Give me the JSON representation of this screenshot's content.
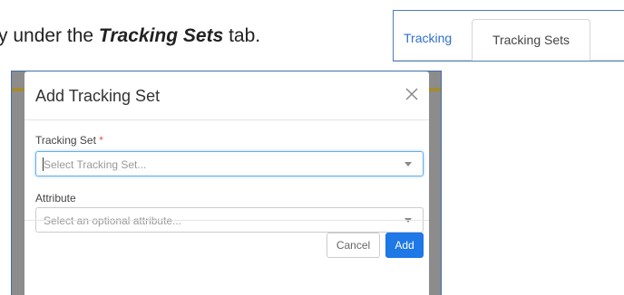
{
  "doc": {
    "prefix": "y under the ",
    "emphasis": "Tracking Sets",
    "suffix": " tab."
  },
  "tabs": {
    "items": [
      {
        "label": "Tracking"
      },
      {
        "label": "Tracking Sets"
      }
    ],
    "active": "Tracking Sets"
  },
  "modal": {
    "title": "Add Tracking Set",
    "close_icon": "close-icon",
    "fields": {
      "tracking_set": {
        "label": "Tracking Set",
        "required_mark": "*",
        "placeholder": "Select Tracking Set..."
      },
      "attribute": {
        "label": "Attribute",
        "placeholder": "Select an optional attribute..."
      }
    },
    "buttons": {
      "cancel": "Cancel",
      "add": "Add"
    }
  },
  "colors": {
    "accent": "#1e78e6",
    "tab_link": "#2f6fca",
    "required": "#d9534f",
    "overlay": "#8c8c8c"
  }
}
